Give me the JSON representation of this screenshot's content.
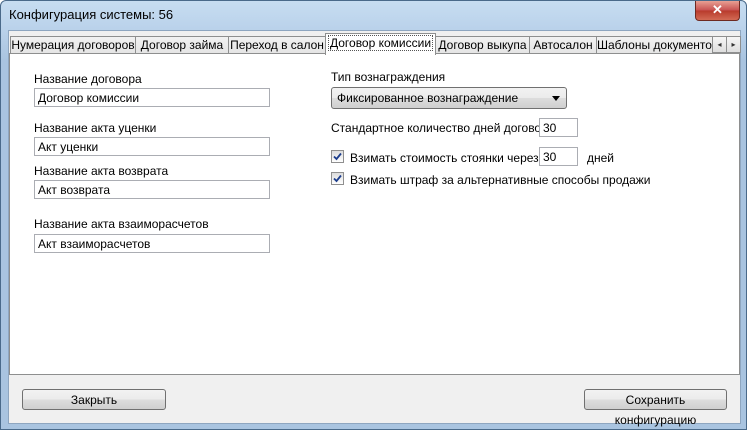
{
  "window": {
    "title": "Конфигурация системы: 56",
    "close_glyph": "✕"
  },
  "tabs": [
    {
      "label": "Нумерация договоров",
      "active": false
    },
    {
      "label": "Договор займа",
      "active": false
    },
    {
      "label": "Переход в салон",
      "active": false
    },
    {
      "label": "Договор комиссии",
      "active": true
    },
    {
      "label": "Договор выкупа",
      "active": false
    },
    {
      "label": "Автосалон",
      "active": false
    },
    {
      "label": "Шаблоны документов",
      "active": false
    }
  ],
  "tab_scroll": {
    "left": "◂",
    "right": "▸"
  },
  "left_form": {
    "contract_name": {
      "label": "Название договора",
      "value": "Договор комиссии"
    },
    "appraisal_act": {
      "label": "Название акта уценки",
      "value": "Акт уценки"
    },
    "return_act": {
      "label": "Название акта возврата",
      "value": "Акт возврата"
    },
    "settlement_act": {
      "label": "Название акта взаиморасчетов",
      "value": "Акт взаиморасчетов"
    }
  },
  "right_form": {
    "reward_type": {
      "label": "Тип вознаграждения",
      "value": "Фиксированное вознаграждение"
    },
    "default_days": {
      "label": "Стандартное количество дней договора",
      "value": "30"
    },
    "parking_fee": {
      "label": "Взимать стоимость стоянки через",
      "value": "30",
      "suffix": "дней",
      "checked": true
    },
    "penalty": {
      "label": "Взимать штраф за альтернативные способы продажи",
      "checked": true
    }
  },
  "buttons": {
    "close": "Закрыть",
    "save": "Сохранить конфигурацию"
  }
}
